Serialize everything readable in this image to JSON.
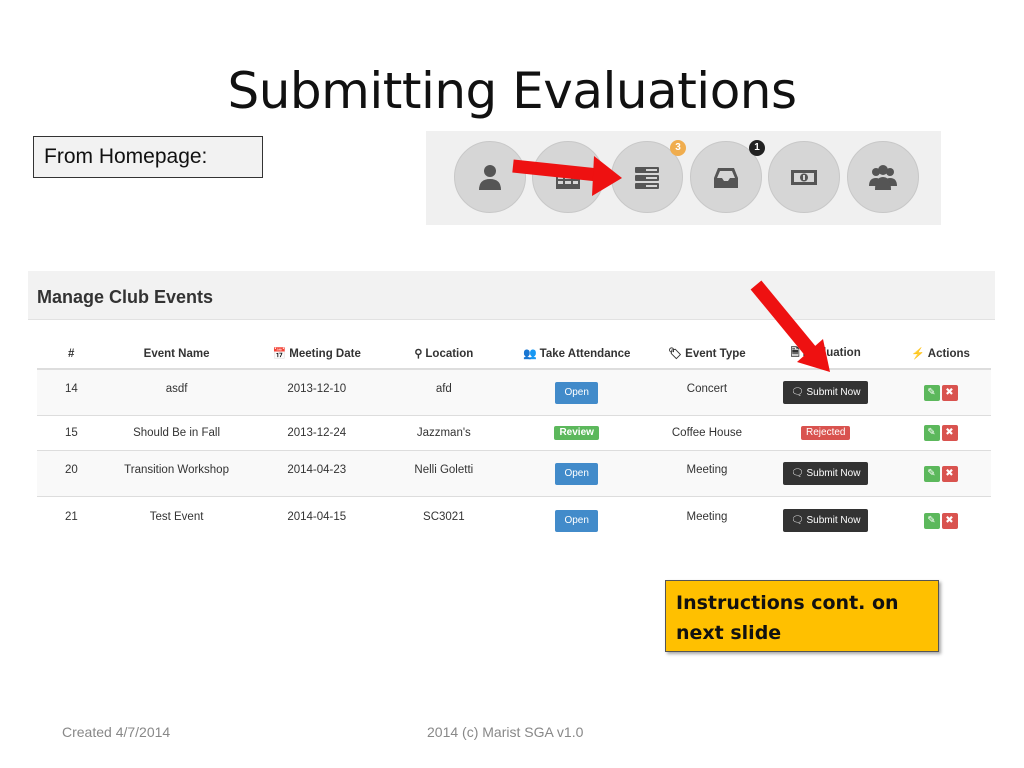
{
  "slide": {
    "title": "Submitting Evaluations",
    "from_label": "From Homepage:",
    "instruction_callout": "Instructions cont. on next slide",
    "footer_left": "Created 4/7/2014",
    "footer_center": "2014 (c) Marist SGA v1.0"
  },
  "home_icons": [
    {
      "name": "user-icon",
      "badge": ""
    },
    {
      "name": "calendar-grid-icon",
      "badge": ""
    },
    {
      "name": "server-list-icon",
      "badge": "3",
      "badge_color": "#f0ad4e"
    },
    {
      "name": "inbox-tray-icon",
      "badge": "1",
      "badge_color": "#222222"
    },
    {
      "name": "money-bill-icon",
      "badge": ""
    },
    {
      "name": "group-icon",
      "badge": ""
    }
  ],
  "panel": {
    "title": "Manage Club Events",
    "columns": {
      "id": "#",
      "event_name": "Event Name",
      "meeting_date": "Meeting Date",
      "location": "Location",
      "take_attendance": "Take Attendance",
      "event_type": "Event Type",
      "evaluation": "Evaluation",
      "actions": "Actions"
    },
    "rows": [
      {
        "id": "14",
        "name": "asdf",
        "date": "2013-12-10",
        "location": "afd",
        "attendance": "Open",
        "type": "Concert",
        "evaluation": "Submit Now"
      },
      {
        "id": "15",
        "name": "Should Be in Fall",
        "date": "2013-12-24",
        "location": "Jazzman's",
        "attendance": "Review",
        "type": "Coffee House",
        "evaluation": "Rejected"
      },
      {
        "id": "20",
        "name": "Transition Workshop",
        "date": "2014-04-23",
        "location": "Nelli Goletti",
        "attendance": "Open",
        "type": "Meeting",
        "evaluation": "Submit Now"
      },
      {
        "id": "21",
        "name": "Test Event",
        "date": "2014-04-15",
        "location": "SC3021",
        "attendance": "Open",
        "type": "Meeting",
        "evaluation": "Submit Now"
      }
    ]
  },
  "colors": {
    "primary_button": "#428bca",
    "success": "#5cb85c",
    "danger": "#d9534f",
    "dark_button": "#333333",
    "callout": "#ffc000",
    "arrow": "#ee1111"
  }
}
